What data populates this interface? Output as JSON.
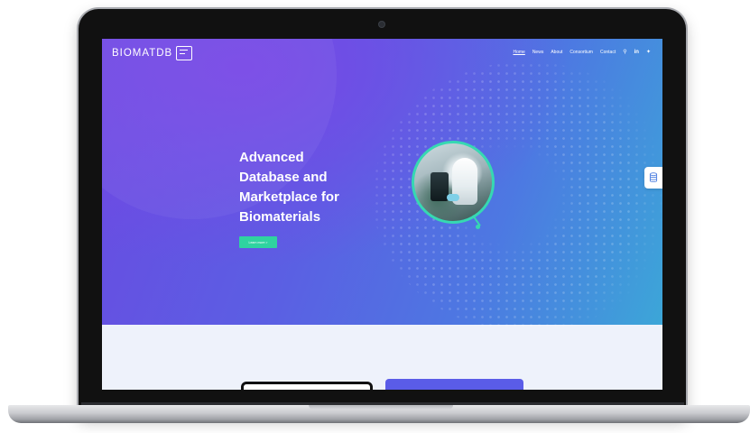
{
  "logo": {
    "text": "BIOMATDB"
  },
  "nav": {
    "links": [
      "Home",
      "News",
      "About",
      "Consortium",
      "Contact"
    ],
    "active": "Home"
  },
  "hero": {
    "title_lines": [
      "Advanced",
      "Database and",
      "Marketplace for",
      "Biomaterials"
    ],
    "cta_label": "Learn more >"
  },
  "icons": {
    "search": "search-icon",
    "linkedin": "linkedin-icon",
    "twitter": "twitter-icon",
    "database": "database-icon"
  },
  "colors": {
    "hero_start": "#6a4ae2",
    "hero_end": "#3ca6d8",
    "accent_green": "#2fd3a0",
    "card_purple": "#5a5ce8"
  }
}
